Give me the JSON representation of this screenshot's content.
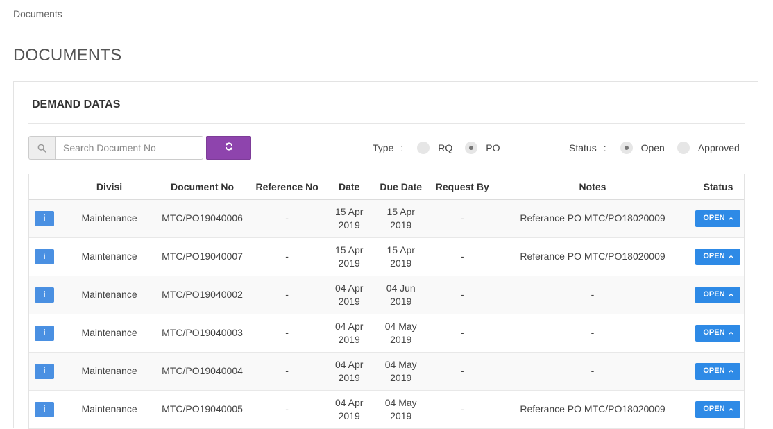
{
  "breadcrumb": "Documents",
  "page_title": "DOCUMENTS",
  "card_title": "DEMAND DATAS",
  "search": {
    "placeholder": "Search Document No",
    "value": ""
  },
  "filters": {
    "type_label": "Type",
    "status_label": "Status",
    "colon": ":",
    "type_options": [
      {
        "label": "RQ",
        "checked": false
      },
      {
        "label": "PO",
        "checked": true
      }
    ],
    "status_options": [
      {
        "label": "Open",
        "checked": true
      },
      {
        "label": "Approved",
        "checked": false
      }
    ]
  },
  "table": {
    "headers": [
      "",
      "Divisi",
      "Document No",
      "Reference No",
      "Date",
      "Due Date",
      "Request By",
      "Notes",
      "Status"
    ],
    "rows": [
      {
        "info": "i",
        "divisi": "Maintenance",
        "doc_no": "MTC/PO19040006",
        "ref_no": "-",
        "date_1": "15 Apr",
        "date_2": "2019",
        "due_1": "15 Apr",
        "due_2": "2019",
        "request_by": "-",
        "notes": "Referance PO MTC/PO18020009",
        "status": "OPEN"
      },
      {
        "info": "i",
        "divisi": "Maintenance",
        "doc_no": "MTC/PO19040007",
        "ref_no": "-",
        "date_1": "15 Apr",
        "date_2": "2019",
        "due_1": "15 Apr",
        "due_2": "2019",
        "request_by": "-",
        "notes": "Referance PO MTC/PO18020009",
        "status": "OPEN"
      },
      {
        "info": "i",
        "divisi": "Maintenance",
        "doc_no": "MTC/PO19040002",
        "ref_no": "-",
        "date_1": "04 Apr",
        "date_2": "2019",
        "due_1": "04 Jun",
        "due_2": "2019",
        "request_by": "-",
        "notes": "-",
        "status": "OPEN"
      },
      {
        "info": "i",
        "divisi": "Maintenance",
        "doc_no": "MTC/PO19040003",
        "ref_no": "-",
        "date_1": "04 Apr",
        "date_2": "2019",
        "due_1": "04 May",
        "due_2": "2019",
        "request_by": "-",
        "notes": "-",
        "status": "OPEN"
      },
      {
        "info": "i",
        "divisi": "Maintenance",
        "doc_no": "MTC/PO19040004",
        "ref_no": "-",
        "date_1": "04 Apr",
        "date_2": "2019",
        "due_1": "04 May",
        "due_2": "2019",
        "request_by": "-",
        "notes": "-",
        "status": "OPEN"
      },
      {
        "info": "i",
        "divisi": "Maintenance",
        "doc_no": "MTC/PO19040005",
        "ref_no": "-",
        "date_1": "04 Apr",
        "date_2": "2019",
        "due_1": "04 May",
        "due_2": "2019",
        "request_by": "-",
        "notes": "Referance PO MTC/PO18020009",
        "status": "OPEN"
      }
    ]
  },
  "icons": {
    "search": "search-icon",
    "refresh": "refresh-icon",
    "info": "info-icon",
    "status_caret": "chevron-up-icon"
  },
  "colors": {
    "refresh_button": "#8e44ad",
    "info_button": "#4a90e2",
    "status_button": "#2e8ae6"
  }
}
